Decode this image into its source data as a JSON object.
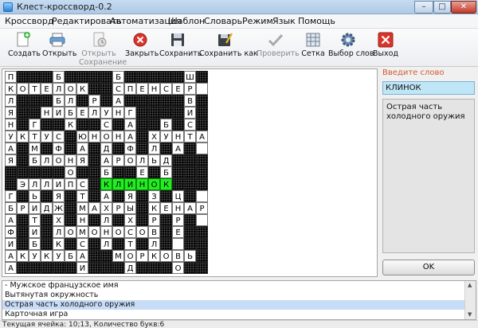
{
  "window": {
    "title": "Клест-кроссворд-0.2",
    "minimize": "–",
    "maximize": "□",
    "close": "✕"
  },
  "menu": [
    "Кроссворд",
    "Редактировать",
    "Автоматизация",
    "Шаблон",
    "Словарь",
    "Режим",
    "Язык",
    "Помощь"
  ],
  "toolbar": {
    "create": "Создать",
    "open": "Открыть",
    "open_saved": "Открыть\nСохранение",
    "close": "Закрыть",
    "save": "Сохранить",
    "save_as": "Сохранить как",
    "check": "Проверить",
    "grid": "Сетка",
    "word_choice": "Выбор слов",
    "exit": "Выход"
  },
  "grid": {
    "rows": [
      "ПБ###Б#####Ш###Н",
      "КОТЕЛОК####СПЕНСЕР",
      "ЛБЛРА#####В",
      "ЯНИБЕЛУНГИ##Е",
      "НГКСАБС",
      "УКТУС#ЮНОНА#ХУНТА",
      "АМФАДФЛА",
      "ЯБЛОНЯАРОЛЬД",
      "ОБЕБД",
      "ЭЛЛИПС##КЛИНОК",
      "ГЬЯТАЯЗЦ",
      "БРИДЖ#МАХРЫ##КЕНАР",
      "АТХНЛХРР",
      "ФИЛОМОНОСОВЕ",
      "ИБКСЛТЛ",
      "АКУКУБА##МОРКОВЬ",
      "АИДОИ"
    ]
  },
  "side": {
    "label": "Введите слово",
    "word": "КЛИНОК",
    "clue": "Острая часть холодного оружия",
    "ok": "OK"
  },
  "clues": [
    " - Мужское французское имя",
    "Вытянутая окружность",
    "Острая часть холодного оружия",
    "Карточная игра"
  ],
  "status": "Текущая ячейка: 10;13, Количество букв:6"
}
